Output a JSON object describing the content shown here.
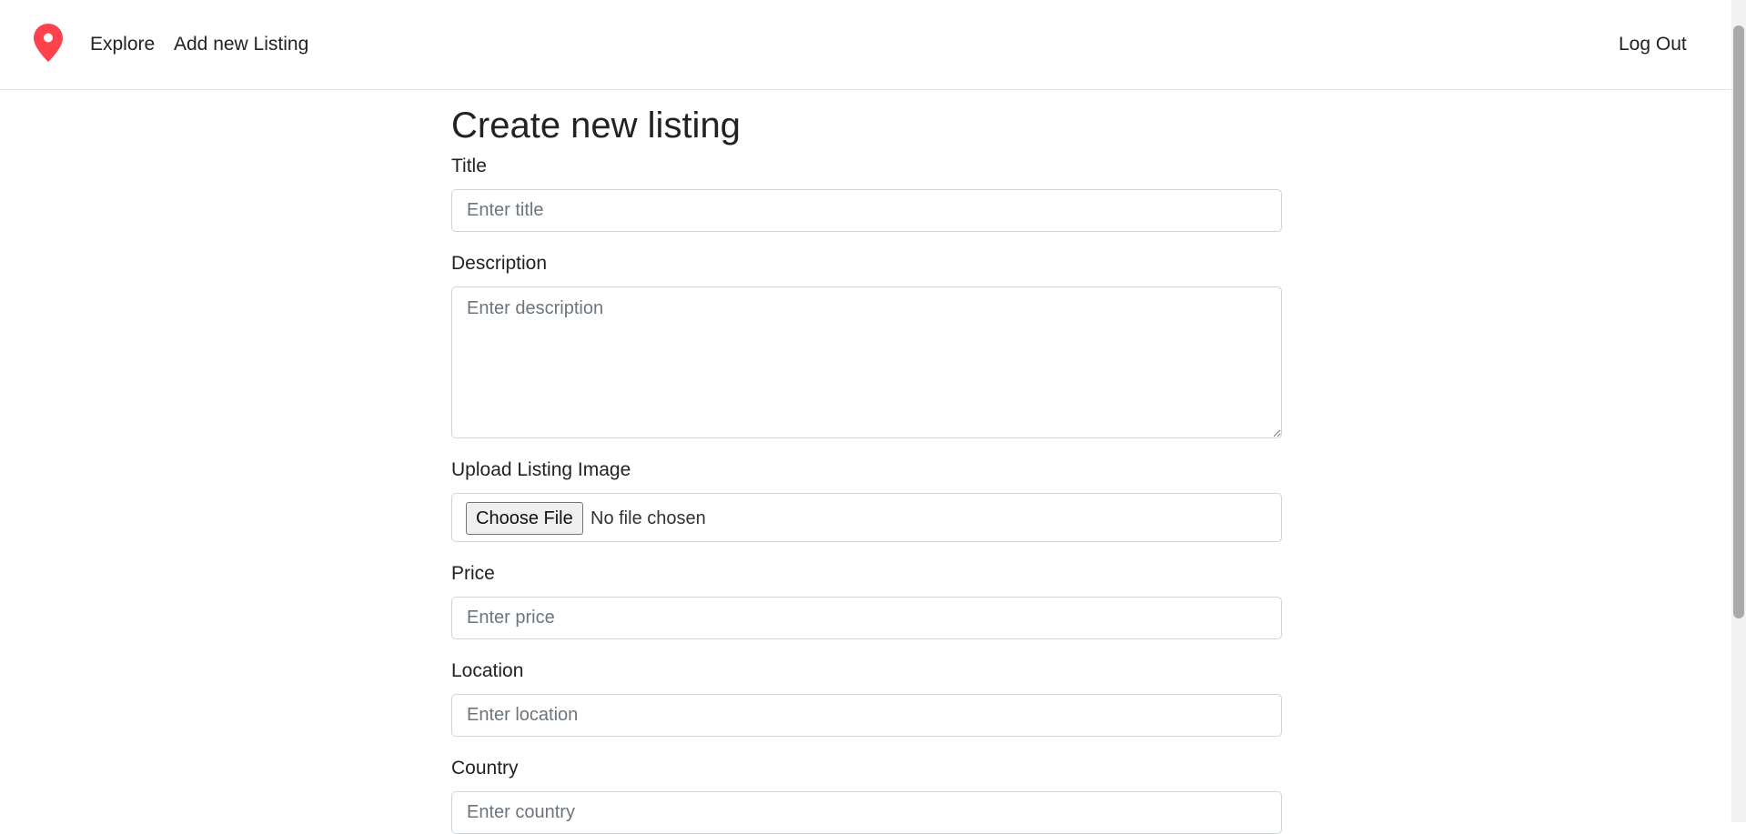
{
  "navbar": {
    "logo_icon": "map-pin-icon",
    "brand_color": "#fe424d",
    "links": {
      "explore": "Explore",
      "add_listing": "Add new Listing",
      "logout": "Log Out"
    }
  },
  "form": {
    "heading": "Create new listing",
    "title": {
      "label": "Title",
      "placeholder": "Enter title",
      "value": ""
    },
    "description": {
      "label": "Description",
      "placeholder": "Enter description",
      "value": ""
    },
    "image": {
      "label": "Upload Listing Image",
      "button_label": "Choose File",
      "status": "No file chosen"
    },
    "price": {
      "label": "Price",
      "placeholder": "Enter price",
      "value": ""
    },
    "location": {
      "label": "Location",
      "placeholder": "Enter location",
      "value": ""
    },
    "country": {
      "label": "Country",
      "placeholder": "Enter country",
      "value": ""
    }
  }
}
